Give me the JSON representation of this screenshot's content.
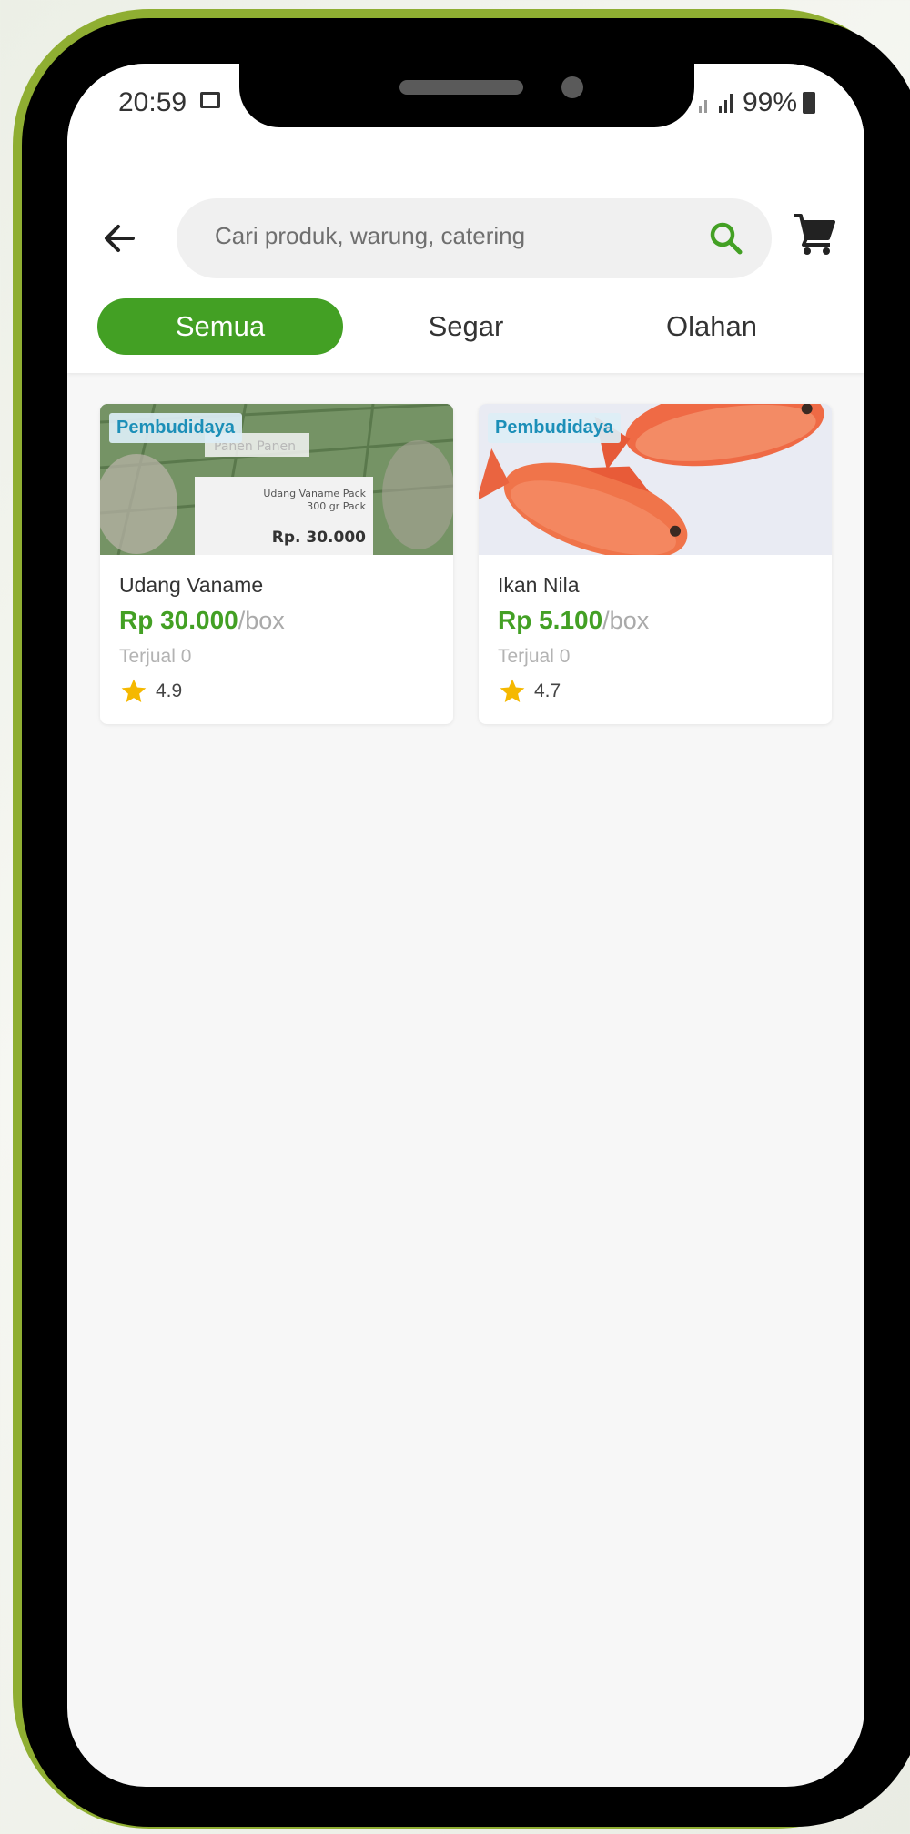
{
  "status_bar": {
    "time": "20:59",
    "battery": "99%"
  },
  "header": {
    "search_placeholder": "Cari produk, warung, catering",
    "tabs": [
      {
        "label": "Semua",
        "active": true
      },
      {
        "label": "Segar",
        "active": false
      },
      {
        "label": "Olahan",
        "active": false
      }
    ]
  },
  "products": [
    {
      "badge": "Pembudidaya",
      "name": "Udang Vaname",
      "price": "Rp 30.000",
      "unit": "/box",
      "sold": "Terjual 0",
      "rating": "4.9",
      "image_text": {
        "brand": "Panen Panen",
        "line1": "Udang Vaname Pack",
        "line2": "300 gr Pack",
        "price": "Rp. 30.000"
      }
    },
    {
      "badge": "Pembudidaya",
      "name": "Ikan Nila",
      "price": "Rp 5.100",
      "unit": "/box",
      "sold": "Terjual 0",
      "rating": "4.7"
    }
  ],
  "colors": {
    "accent": "#43a024",
    "frame": "#8fae32",
    "badge_text": "#1c8fb8",
    "star": "#f5b800"
  },
  "icons": [
    "back-arrow-icon",
    "search-icon",
    "cart-icon",
    "star-icon",
    "image-icon",
    "battery-icon"
  ]
}
